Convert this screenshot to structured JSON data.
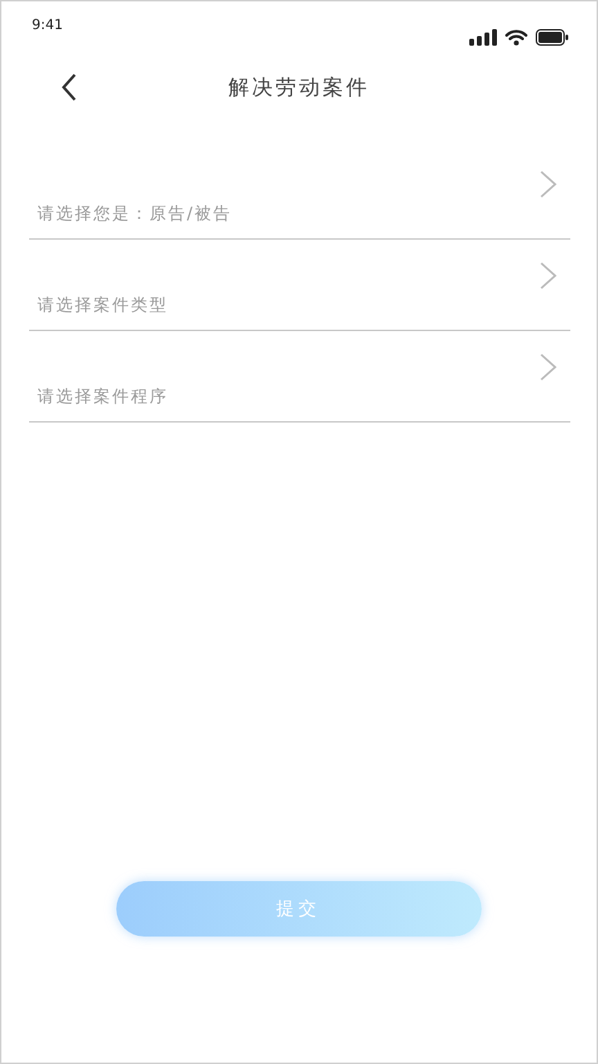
{
  "status_bar": {
    "time": "9:41"
  },
  "header": {
    "title": "解决劳动案件"
  },
  "fields": [
    {
      "placeholder": "请选择您是：原告/被告"
    },
    {
      "placeholder": "请选择案件类型"
    },
    {
      "placeholder": "请选择案件程序"
    }
  ],
  "submit_button": {
    "label": "提交"
  }
}
